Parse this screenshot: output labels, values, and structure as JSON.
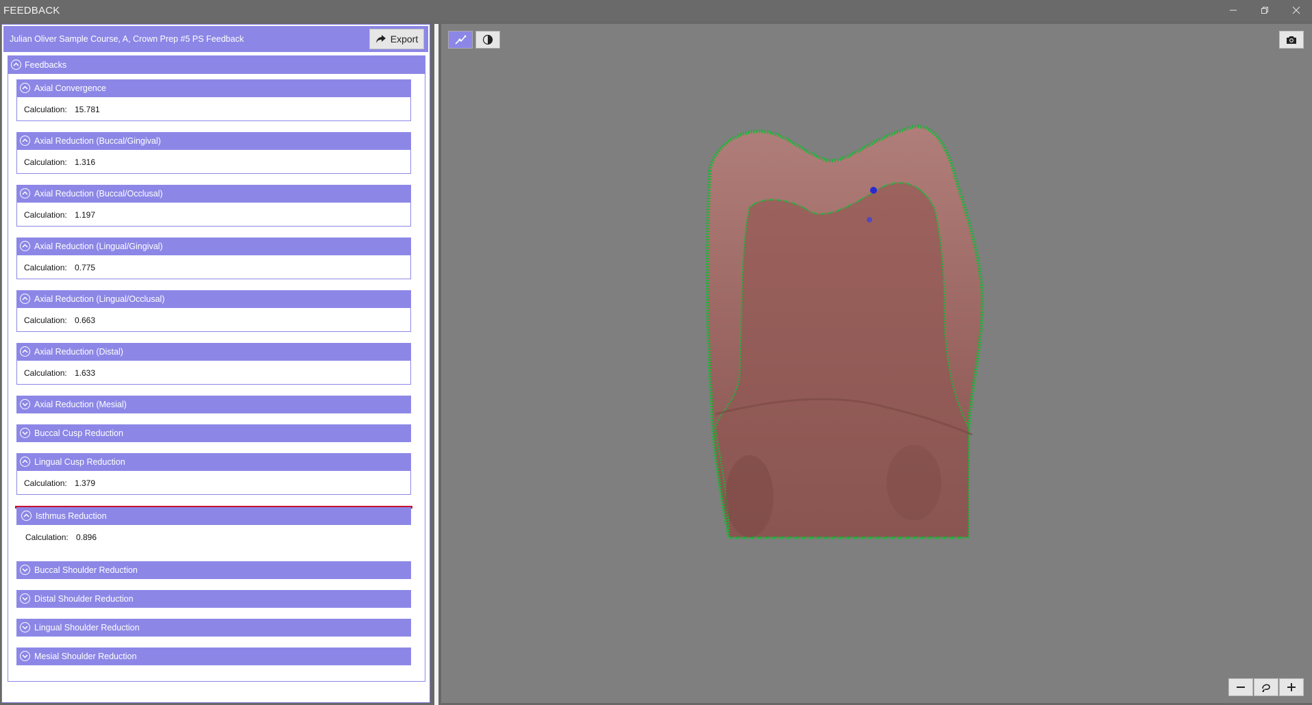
{
  "window": {
    "title": "FEEDBACK",
    "minimize_icon": "minimize-icon",
    "restore_icon": "restore-icon",
    "close_icon": "close-icon"
  },
  "header": {
    "title": "Julian Oliver Sample Course, A, Crown Prep #5 PS Feedback",
    "export_label": "Export"
  },
  "feedbacks": {
    "title": "Feedbacks",
    "calc_label": "Calculation:",
    "items": [
      {
        "label": "Axial Convergence",
        "expanded": true,
        "value": "15.781"
      },
      {
        "label": "Axial Reduction (Buccal/Gingival)",
        "expanded": true,
        "value": "1.316"
      },
      {
        "label": "Axial Reduction (Buccal/Occlusal)",
        "expanded": true,
        "value": "1.197"
      },
      {
        "label": "Axial Reduction (Lingual/Gingival)",
        "expanded": true,
        "value": "0.775"
      },
      {
        "label": "Axial Reduction (Lingual/Occlusal)",
        "expanded": true,
        "value": "0.663"
      },
      {
        "label": "Axial Reduction (Distal)",
        "expanded": true,
        "value": "1.633"
      },
      {
        "label": "Axial Reduction (Mesial)",
        "expanded": false
      },
      {
        "label": "Buccal Cusp Reduction",
        "expanded": false
      },
      {
        "label": "Lingual Cusp Reduction",
        "expanded": true,
        "value": "1.379"
      },
      {
        "label": "Isthmus Reduction",
        "expanded": true,
        "value": "0.896",
        "selected": true
      },
      {
        "label": "Buccal Shoulder Reduction",
        "expanded": false
      },
      {
        "label": "Distal Shoulder Reduction",
        "expanded": false
      },
      {
        "label": "Lingual Shoulder Reduction",
        "expanded": false
      },
      {
        "label": "Mesial Shoulder Reduction",
        "expanded": false
      }
    ]
  },
  "viewport": {
    "tools": [
      "measure-icon",
      "contrast-icon"
    ],
    "camera_icon": "camera-icon",
    "zoom": [
      "zoom-out-icon",
      "reset-view-icon",
      "zoom-in-icon"
    ],
    "colors": {
      "background": "#7f7f7f",
      "tooth": "#9e6a66",
      "margin_line": "#1fb33a",
      "marker": "#2a2ad0",
      "accent": "#8c87e6",
      "selected_border": "#c8102e"
    }
  }
}
